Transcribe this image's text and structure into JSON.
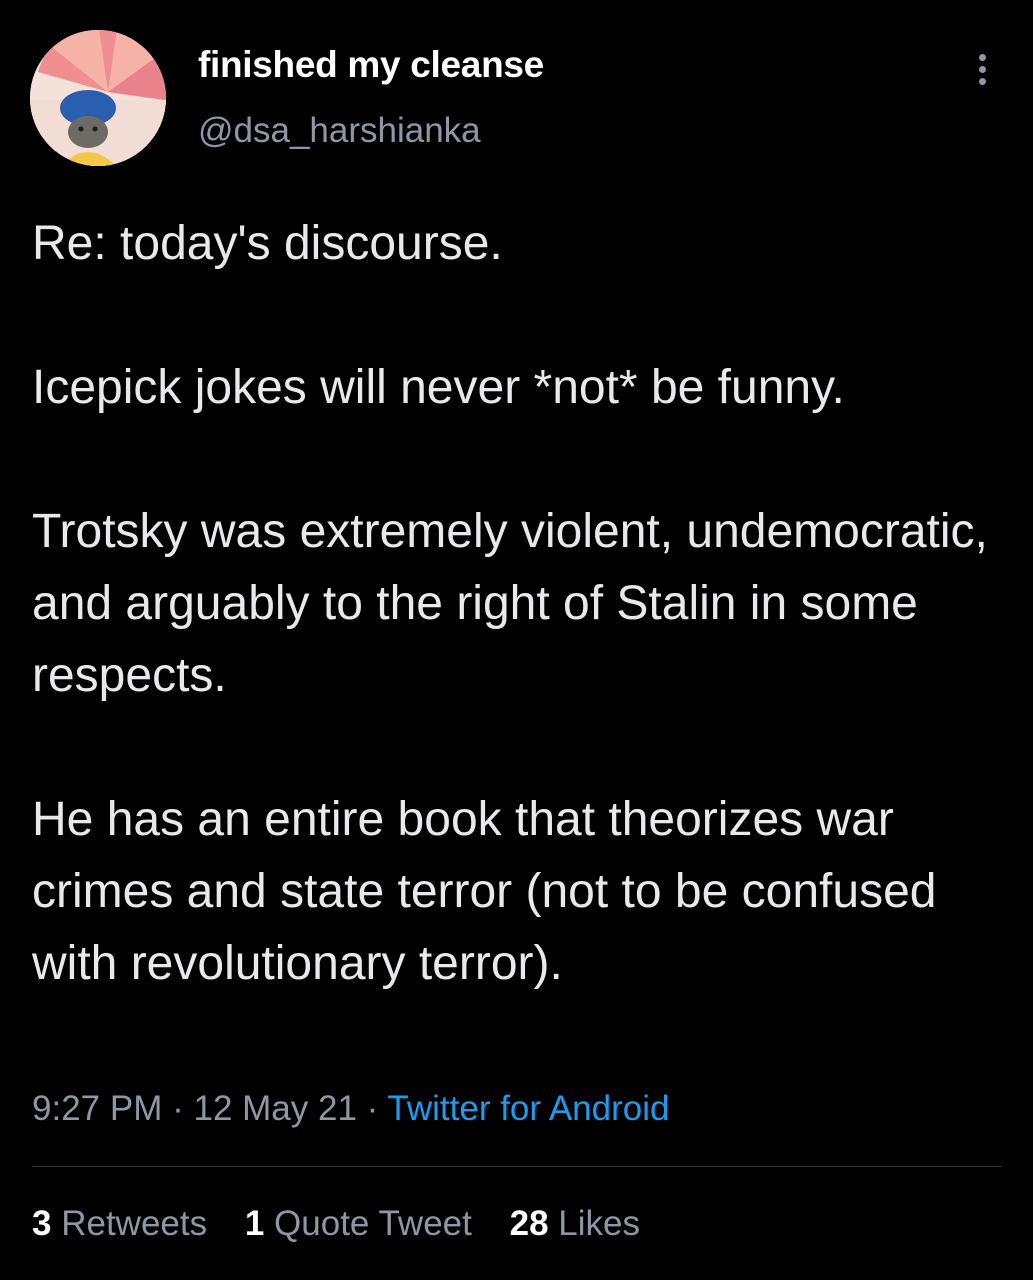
{
  "author": {
    "display_name": "finished my cleanse",
    "handle": "@dsa_harshianka"
  },
  "tweet": {
    "paragraphs": [
      "Re: today's discourse.",
      "Icepick jokes will never *not* be funny.",
      "Trotsky was extremely violent, undemocratic, and arguably to the right of Stalin in some respects.",
      "He has an entire book that theorizes war crimes and state terror (not to be confused with revolutionary terror)."
    ],
    "time": "9:27 PM",
    "date": "12 May 21",
    "separator": "·",
    "source": "Twitter for Android"
  },
  "stats": {
    "retweets_count": "3",
    "retweets_label": "Retweets",
    "quotes_count": "1",
    "quotes_label": "Quote Tweet",
    "likes_count": "28",
    "likes_label": "Likes"
  },
  "icons": {
    "more": "more-vertical-icon"
  },
  "colors": {
    "background": "#000000",
    "text": "#e7e9ea",
    "secondary": "#8b98a5",
    "link": "#1d9bf0",
    "divider": "#2f3336"
  }
}
